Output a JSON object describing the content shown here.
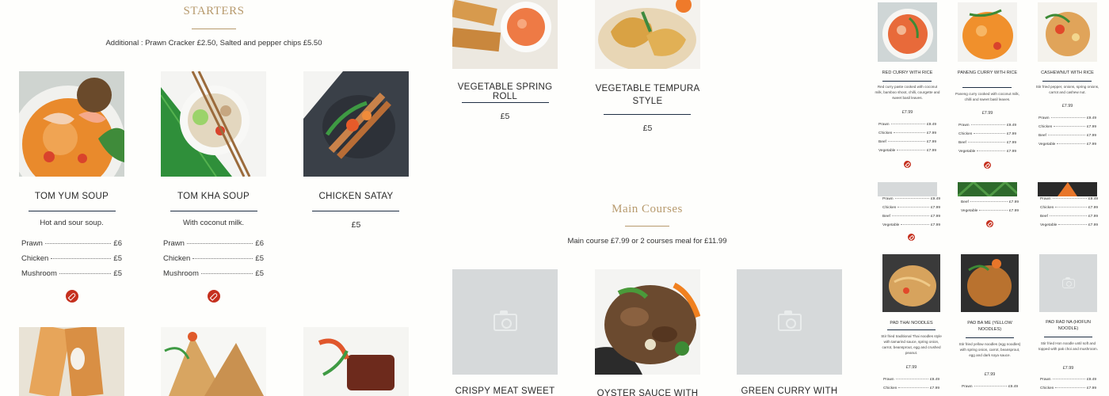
{
  "starters": {
    "title": "STARTERS",
    "note": "Additional : Prawn Cracker £2.50, Salted and pepper chips £5.50",
    "items": [
      {
        "name": "TOM YUM SOUP",
        "desc": "Hot and sour soup.",
        "prices": [
          {
            "label": "Prawn",
            "amount": "£6"
          },
          {
            "label": "Chicken",
            "amount": "£5"
          },
          {
            "label": "Mushroom",
            "amount": "£5"
          }
        ]
      },
      {
        "name": "TOM KHA SOUP",
        "desc": "With coconut milk.",
        "prices": [
          {
            "label": "Prawn",
            "amount": "£6"
          },
          {
            "label": "Chicken",
            "amount": "£5"
          },
          {
            "label": "Mushroom",
            "amount": "£5"
          }
        ]
      },
      {
        "name": "CHICKEN SATAY",
        "price": "£5"
      }
    ]
  },
  "more_starters": [
    {
      "name": "VEGETABLE SPRING ROLL",
      "price": "£5"
    },
    {
      "name": "VEGETABLE TEMPURA STYLE",
      "price": "£5"
    }
  ],
  "main_courses": {
    "title": "Main Courses",
    "note": "Main course £7.99 or 2 courses meal for £11.99",
    "items": [
      {
        "name": "CRISPY MEAT SWEET"
      },
      {
        "name": "OYSTER SAUCE WITH"
      },
      {
        "name": "GREEN CURRY WITH RICE"
      }
    ]
  },
  "preview": {
    "curries": [
      {
        "name": "RED CURRY WITH RICE",
        "desc": "Red curry paste cooked with coconut milk, bamboo shoot, chilli, courgette and sweet basil leaves.",
        "price": "£7.99",
        "prices": [
          {
            "label": "Prawn",
            "amount": "£9.49"
          },
          {
            "label": "Chicken",
            "amount": "£7.99"
          },
          {
            "label": "Beef",
            "amount": "£7.99"
          },
          {
            "label": "Vegetable",
            "amount": "£7.99"
          }
        ]
      },
      {
        "name": "PANENG CURRY WITH RICE",
        "desc": "Paneng curry cooked with coconut milk, chilli and sweet basil leaves.",
        "price": "£7.99",
        "prices": [
          {
            "label": "Prawn",
            "amount": "£9.49"
          },
          {
            "label": "Chicken",
            "amount": "£7.99"
          },
          {
            "label": "Beef",
            "amount": "£7.99"
          },
          {
            "label": "Vegetable",
            "amount": "£7.99"
          }
        ]
      },
      {
        "name": "CASHEWNUT WITH RICE",
        "desc": "Stir fried pepper, onions, spring onions, carrot and cashew nut.",
        "price": "£7.99",
        "prices": [
          {
            "label": "Prawn",
            "amount": "£9.49"
          },
          {
            "label": "Chicken",
            "amount": "£7.99"
          },
          {
            "label": "Beef",
            "amount": "£7.99"
          },
          {
            "label": "Vegetable",
            "amount": "£7.99"
          }
        ]
      }
    ],
    "row2": [
      {
        "prices": [
          {
            "label": "Prawn",
            "amount": "£9.49"
          },
          {
            "label": "Chicken",
            "amount": "£7.99"
          },
          {
            "label": "Beef",
            "amount": "£7.99"
          },
          {
            "label": "Vegetable",
            "amount": "£7.99"
          }
        ]
      },
      {
        "prices": [
          {
            "label": "Beef",
            "amount": "£7.99"
          },
          {
            "label": "Vegetable",
            "amount": "£7.99"
          }
        ]
      },
      {
        "prices": [
          {
            "label": "Prawn",
            "amount": "£9.49"
          },
          {
            "label": "Chicken",
            "amount": "£7.99"
          },
          {
            "label": "Beef",
            "amount": "£7.99"
          },
          {
            "label": "Vegetable",
            "amount": "£7.99"
          }
        ]
      }
    ],
    "noodles": [
      {
        "name": "PAD THAI NOODLES",
        "desc": "Stir fried traditional Thai noodles style with tamarind sauce, spring onion, carrot, beansprout, egg and crushed peanut.",
        "price": "£7.99",
        "prices": [
          {
            "label": "Prawn",
            "amount": "£9.49"
          },
          {
            "label": "Chicken",
            "amount": "£7.99"
          }
        ]
      },
      {
        "name": "PAD BA ME (YELLOW NOODLES)",
        "desc": "Stir fried yellow noodles (egg noodles) with spring onion, carrot, beansprout, egg and dark soya sauce.",
        "price": "£7.99",
        "prices": [
          {
            "label": "Prawn",
            "amount": "£9.49"
          }
        ]
      },
      {
        "name": "PAD RAD NA (HOFUN NOODLE)",
        "desc": "Stir fried Hon noodle until soft and topped with pak choi and mushroom.",
        "price": "£7.99",
        "prices": [
          {
            "label": "Prawn",
            "amount": "£9.49"
          },
          {
            "label": "Chicken",
            "amount": "£7.99"
          }
        ]
      }
    ]
  },
  "colors": {
    "gold": "#b79a6d",
    "navy_rule": "#1f2f44",
    "chili_red": "#c5301e",
    "placeholder_gray": "#d6d9da"
  },
  "icons": {
    "chili": "chili-spicy-icon",
    "camera": "camera-placeholder-icon"
  }
}
